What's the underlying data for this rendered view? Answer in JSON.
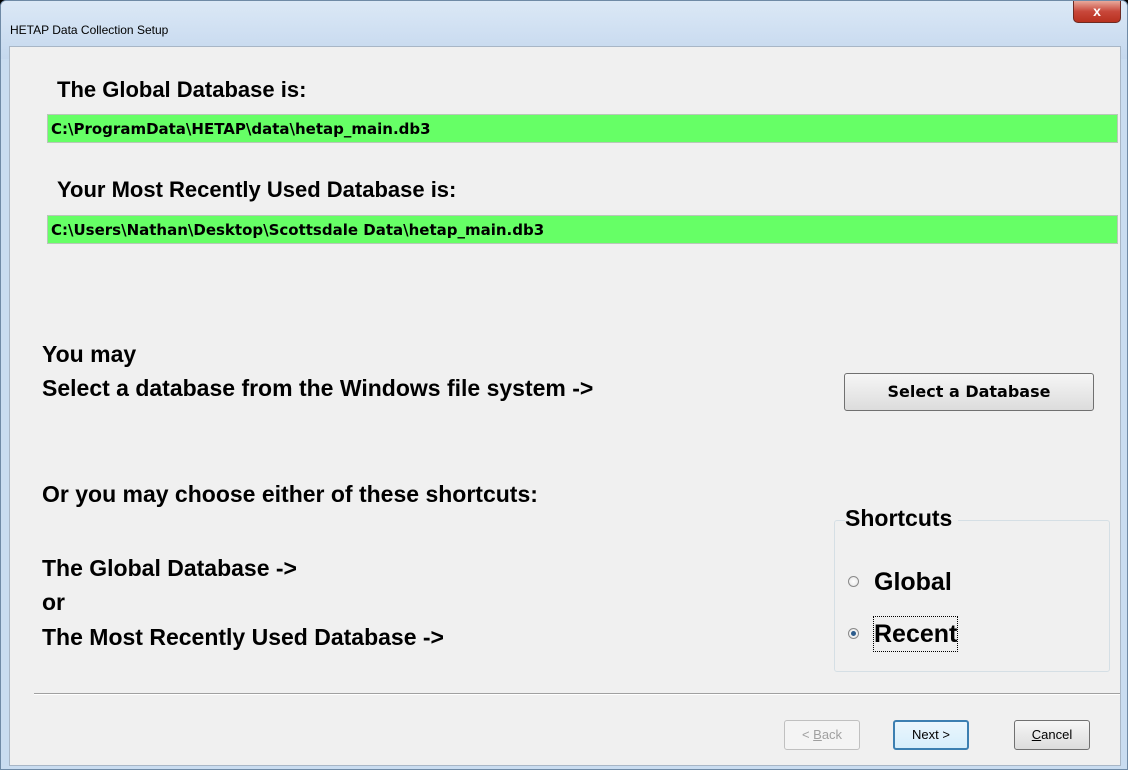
{
  "window": {
    "title": "HETAP Data Collection Setup",
    "close_label": "x"
  },
  "global_db": {
    "heading": "The Global Database is:",
    "path": "C:\\ProgramData\\HETAP\\data\\hetap_main.db3"
  },
  "recent_db": {
    "heading": "Your Most Recently Used Database is:",
    "path": "C:\\Users\\Nathan\\Desktop\\Scottsdale Data\\hetap_main.db3"
  },
  "select": {
    "line1": "You may",
    "line2": "Select a database from the Windows file system ->",
    "button_label": "Select a Database"
  },
  "shortcuts_text": {
    "intro": "Or you may choose either of these shortcuts:",
    "global_line": "The Global Database ->",
    "or_line": "or",
    "recent_line": "The Most Recently Used Database ->"
  },
  "shortcuts": {
    "title": "Shortcuts",
    "options": [
      {
        "label": "Global",
        "checked": false
      },
      {
        "label": "Recent",
        "checked": true
      }
    ]
  },
  "nav": {
    "back": {
      "prefix": "< ",
      "accel": "B",
      "rest": "ack",
      "enabled": false
    },
    "next": {
      "label": "Next >",
      "default": true
    },
    "cancel": {
      "accel": "C",
      "rest": "ancel"
    }
  },
  "colors": {
    "path_highlight": "#66ff66",
    "client_bg": "#f0f0f0"
  }
}
